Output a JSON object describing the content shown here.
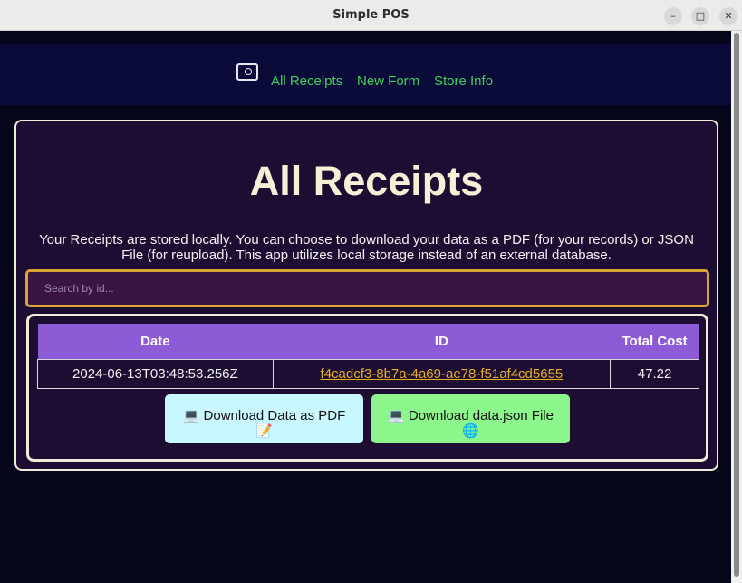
{
  "window": {
    "title": "Simple POS",
    "minimize_glyph": "–",
    "maximize_glyph": "□",
    "close_glyph": "✕"
  },
  "nav": {
    "icon": "receipt-box-icon",
    "links": [
      {
        "label": "All Receipts"
      },
      {
        "label": "New Form"
      },
      {
        "label": "Store Info"
      }
    ]
  },
  "main": {
    "title": "All Receipts",
    "description": "Your Receipts are stored locally. You can choose to download your data as a PDF (for your records) or JSON File (for reupload). This app utilizes local storage instead of an external database.",
    "search": {
      "placeholder": "Search by id...",
      "value": ""
    },
    "table": {
      "headers": [
        "Date",
        "ID",
        "Total Cost"
      ],
      "rows": [
        {
          "date": "2024-06-13T03:48:53.256Z",
          "id": "f4cadcf3-8b7a-4a69-ae78-f51af4cd5655",
          "total": "47.22"
        }
      ]
    },
    "buttons": {
      "pdf": {
        "line1": "💻 Download Data as PDF",
        "line2": "📝"
      },
      "json": {
        "line1": "💻 Download data.json File",
        "line2": "🌐"
      }
    }
  },
  "colors": {
    "background": "#06061a",
    "navbar": "#0b0b3a",
    "nav_link": "#3fd05b",
    "card": "#1d0d33",
    "table_header": "#8e5bd6",
    "id_link": "#e6b022",
    "search_border": "#d8a535",
    "pdf_button": "#c9f7ff",
    "json_button": "#8cf58c"
  }
}
